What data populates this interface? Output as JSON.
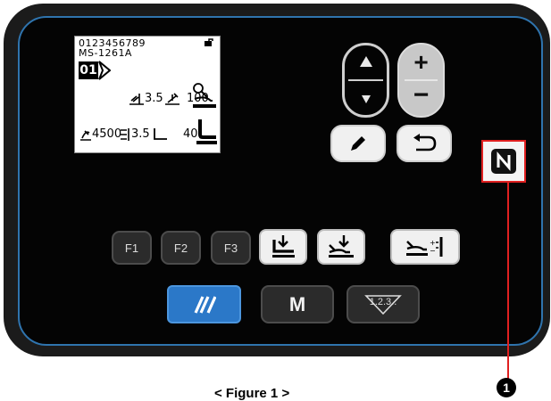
{
  "lcd": {
    "line1": "0123456789",
    "line2": "MS-1261A",
    "pattern_number": "01",
    "stitch_length_top": "3.5",
    "presser_pressure": "100",
    "speed": "4500",
    "stitch_length_bottom": "3.5",
    "foot_height": "40"
  },
  "function_keys": [
    "F1",
    "F2",
    "F3"
  ],
  "mode_key": "M",
  "counter_key": "1.2.3..",
  "callout_number": "1",
  "caption": "< Figure 1 >",
  "colors": {
    "reset_key": "#2b78c8",
    "callout_line": "#e02020",
    "panel_border": "#2f74ae"
  },
  "icons": [
    "lock-icon",
    "up-arrow-icon",
    "down-arrow-icon",
    "plus-icon",
    "minus-icon",
    "edit-pencil-icon",
    "return-icon",
    "nfc-icon",
    "presser-foot-icon",
    "thread-trim-icon",
    "reverse-stitch-icon",
    "reset-icon"
  ]
}
